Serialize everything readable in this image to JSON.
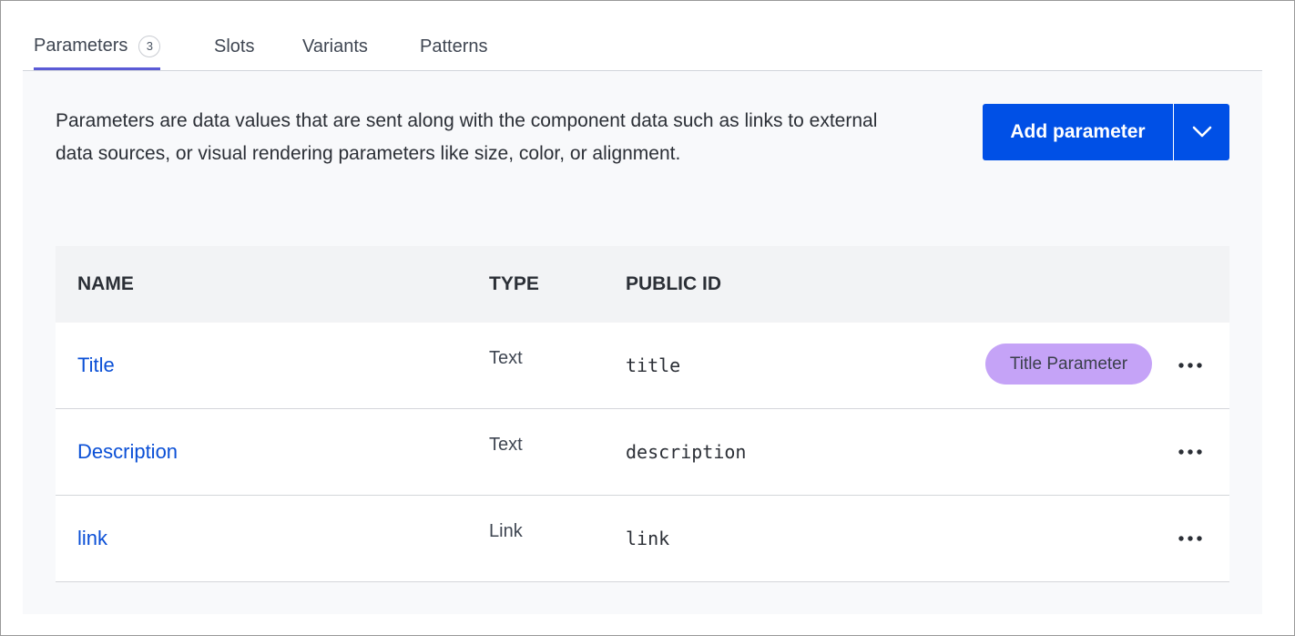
{
  "tabs": [
    {
      "label": "Parameters",
      "badge": "3",
      "active": true
    },
    {
      "label": "Slots"
    },
    {
      "label": "Variants"
    },
    {
      "label": "Patterns"
    }
  ],
  "panel": {
    "description": "Parameters are data values that are sent along with the component data such as links to external data sources, or visual rendering parameters like size, color, or alignment.",
    "add_button_label": "Add parameter",
    "dropdown_icon": "chevron-down-icon"
  },
  "table": {
    "headers": {
      "name": "NAME",
      "type": "TYPE",
      "public_id": "PUBLIC ID"
    },
    "rows": [
      {
        "name": "Title",
        "type": "Text",
        "public_id": "title",
        "badge": "Title Parameter",
        "menu_icon": "more-horizontal-icon"
      },
      {
        "name": "Description",
        "type": "Text",
        "public_id": "description",
        "menu_icon": "more-horizontal-icon"
      },
      {
        "name": "link",
        "type": "Link",
        "public_id": "link",
        "menu_icon": "more-horizontal-icon"
      }
    ]
  },
  "colors": {
    "accent": "#0050e6",
    "tab_indicator": "#5b5bd6",
    "link": "#0a4fd6",
    "badge_bg": "#c5a3f7"
  }
}
